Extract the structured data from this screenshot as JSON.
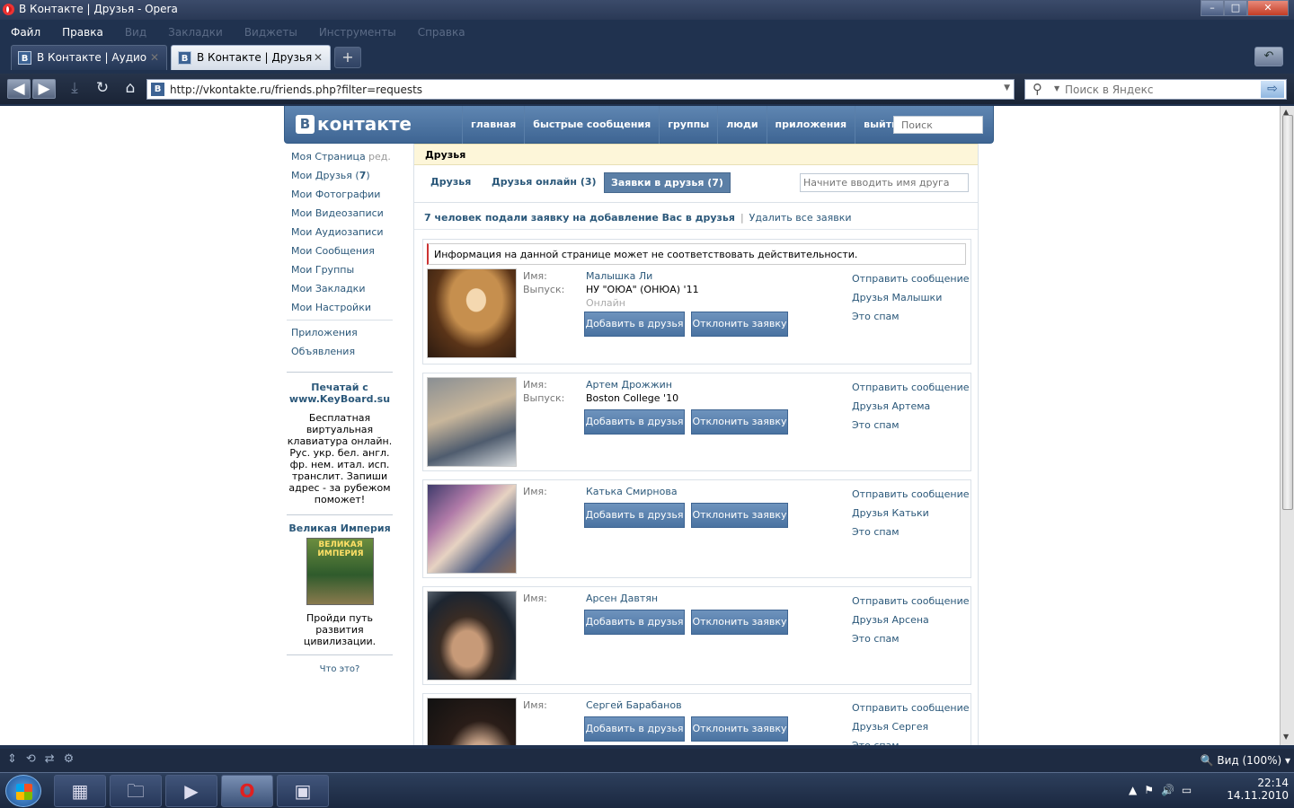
{
  "window": {
    "title": "В Контакте | Друзья - Opera",
    "minimize": "–",
    "maximize": "□",
    "close": "✕"
  },
  "menu": [
    "Файл",
    "Правка",
    "Вид",
    "Закладки",
    "Виджеты",
    "Инструменты",
    "Справка"
  ],
  "tabs": [
    {
      "label": "В Контакте | Аудио",
      "icon": "В"
    },
    {
      "label": "В Контакте | Друзья",
      "icon": "В"
    }
  ],
  "newtab": "+",
  "address": {
    "url": "http://vkontakte.ru/friends.php?filter=requests",
    "favicon": "B"
  },
  "websearch": {
    "placeholder": "Поиск в Яндекс"
  },
  "vk": {
    "logo_b": "B",
    "logo_text": "контакте",
    "nav": [
      "главная",
      "быстрые сообщения",
      "группы",
      "люди",
      "приложения",
      "выйти"
    ],
    "search_placeholder": "Поиск",
    "left_menu": [
      {
        "label": "Моя Страница",
        "extra": "ред."
      },
      {
        "label": "Мои Друзья",
        "count": "7"
      },
      {
        "label": "Мои Фотографии"
      },
      {
        "label": "Мои Видеозаписи"
      },
      {
        "label": "Мои Аудиозаписи"
      },
      {
        "label": "Мои Сообщения"
      },
      {
        "label": "Мои Группы"
      },
      {
        "label": "Мои Закладки"
      },
      {
        "label": "Мои Настройки"
      }
    ],
    "left_extra": [
      "Приложения",
      "Объявления"
    ],
    "promo1": {
      "title": "Печатай с www.KeyBoard.su",
      "text": "Бесплатная виртуальная клавиатура онлайн. Рус. укр. бел. англ. фр. нем. итал. исп. транслит. Запиши адрес - за рубежом поможет!"
    },
    "promo2": {
      "title": "Великая Империя",
      "image_text": "ВЕЛИКАЯ ИМПЕРИЯ",
      "text": "Пройди путь развития цивилизации."
    },
    "what_is": "Что это?",
    "page_title": "Друзья",
    "filter_tabs": [
      "Друзья",
      "Друзья онлайн (3)",
      "Заявки в друзья (7)"
    ],
    "filter_placeholder": "Начните вводить имя друга",
    "summary": "7 человек подали заявку на добавление Вас в друзья",
    "summary_sep": "|",
    "delete_all": "Удалить все заявки",
    "warning": "Информация на данной странице может не соответствовать действительности.",
    "labels": {
      "name": "Имя:",
      "grad": "Выпуск:"
    },
    "buttons": {
      "add": "Добавить в друзья",
      "decline": "Отклонить заявку"
    },
    "actions": {
      "message": "Отправить сообщение",
      "spam": "Это спам"
    },
    "requests": [
      {
        "name": "Малышка Ли",
        "grad": "НУ \"ОЮА\" (ОНЮА) '11",
        "status": "Онлайн",
        "friends": "Друзья Малышки"
      },
      {
        "name": "Артем Дрожжин",
        "grad": "Boston College '10",
        "friends": "Друзья Артема"
      },
      {
        "name": "Катька Смирнова",
        "friends": "Друзья Катьки"
      },
      {
        "name": "Арсен Давтян",
        "friends": "Друзья Арсена"
      },
      {
        "name": "Сергей Барабанов",
        "friends": "Друзья Сергея"
      }
    ]
  },
  "status": {
    "zoom": "Вид (100%)"
  },
  "clock": {
    "time": "22:14",
    "date": "14.11.2010"
  }
}
